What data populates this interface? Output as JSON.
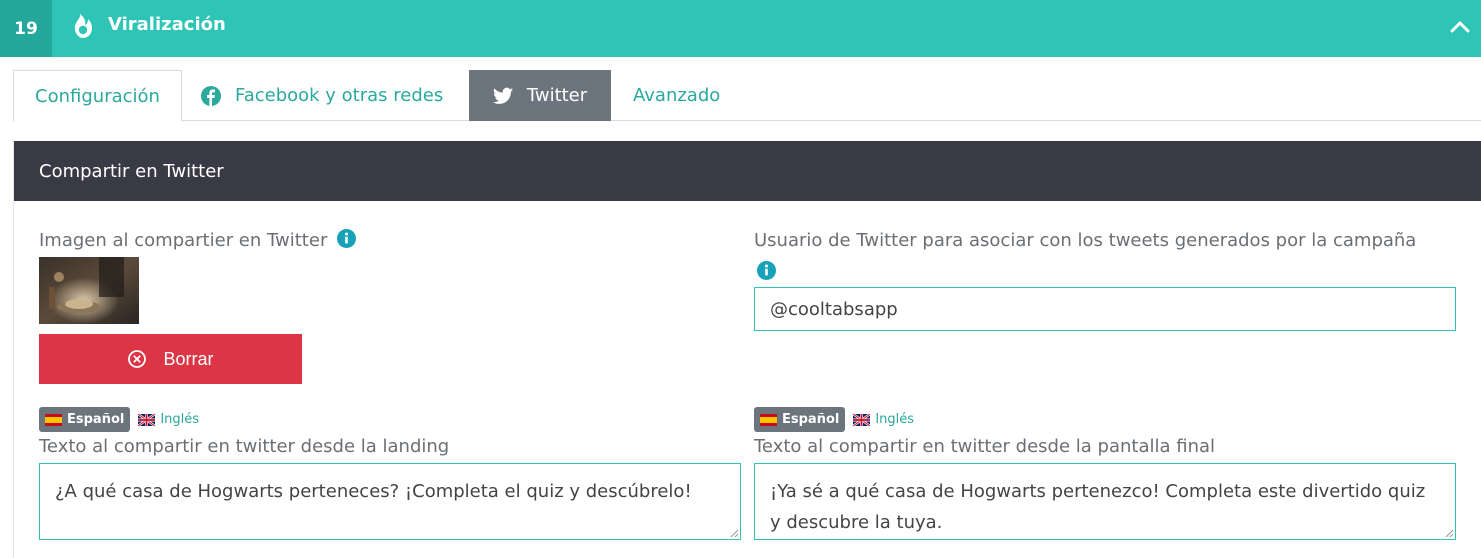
{
  "header": {
    "step_number": "19",
    "title": "Viralización",
    "icon": "flame-icon",
    "accent_color": "#2ec4b6"
  },
  "tabs": [
    {
      "label": "Configuración",
      "active": false
    },
    {
      "label": "Facebook y otras redes",
      "icon": "facebook-icon",
      "active": false
    },
    {
      "label": "Twitter",
      "icon": "twitter-icon",
      "active": true
    },
    {
      "label": "Avanzado",
      "active": false
    }
  ],
  "card": {
    "title": "Compartir en Twitter",
    "image_label": "Imagen al compartier en Twitter",
    "delete_label": "Borrar",
    "user_label": "Usuario de Twitter para asociar con los tweets generados por la campaña",
    "user_value": "@cooltabsapp",
    "languages": {
      "active": "Español",
      "inactive": "Inglés"
    },
    "landing_label": "Texto al compartir en twitter desde la landing",
    "landing_text": "¿A qué casa de Hogwarts perteneces? ¡Completa el quiz y descúbrelo!",
    "final_label": "Texto al compartir en twitter desde la pantalla final",
    "final_text": "¡Ya sé a qué casa de Hogwarts pertenezco! Completa este divertido quiz y descubre la tuya."
  },
  "colors": {
    "header_bar": "#2ec4b6",
    "card_header": "#393a45",
    "active_tab": "#6c757d",
    "danger": "#dc3545",
    "info": "#17a2b8"
  }
}
